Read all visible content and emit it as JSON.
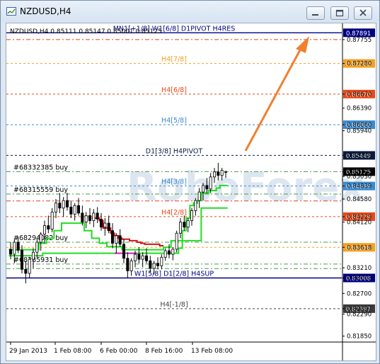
{
  "window": {
    "title": "NZDUSD,H4"
  },
  "chart_data": {
    "type": "candlestick",
    "symbol_line": "NZDUSD,H4  0.85111 0.85147 0.85001 0.85125",
    "price_labels": [
      "0.87755",
      "0.87280",
      "0.86670",
      "0.86390",
      "0.86060",
      "0.85940",
      "0.85449",
      "0.85125",
      "0.85030",
      "0.84839",
      "0.84580",
      "0.84229",
      "0.84120",
      "0.83618",
      "0.83210",
      "0.83008",
      "0.82700",
      "0.82397",
      "0.82290",
      "0.81850"
    ],
    "ylim": [
      0.8176,
      0.8805
    ],
    "time_labels": [
      "29 Jan 2013",
      "1 Feb 08:00",
      "6 Feb 00:00",
      "8 Feb 16:00",
      "13 Feb 08:00"
    ],
    "levels": [
      {
        "name": "MN1[+1/8] W1[6/8] D1PIVOT H4RES",
        "value": 0.87891,
        "badge": "0.87891",
        "color": "#000080",
        "style": "solid",
        "badge_bg": "#000080",
        "badge_fg": "#ffffff"
      },
      {
        "name": "",
        "value": 0.87755,
        "badge": "",
        "color": "#e04020",
        "style": "dashdot",
        "badge_bg": "",
        "badge_fg": ""
      },
      {
        "name": "H4[7/8]",
        "value": 0.8728,
        "badge": "0.87280",
        "color": "#f5a020",
        "style": "dash",
        "badge_bg": "#f5a020",
        "badge_fg": "#ffffff"
      },
      {
        "name": "H4[6/8]",
        "value": 0.8667,
        "badge": "0.86670",
        "color": "#e84818",
        "style": "dash",
        "badge_bg": "#e84818",
        "badge_fg": "#ffffff"
      },
      {
        "name": "H4[5/8]",
        "value": 0.8606,
        "badge": "0.86060",
        "color": "#3a8ad0",
        "style": "dash",
        "badge_bg": "#3a8ad0",
        "badge_fg": "#ffffff"
      },
      {
        "name": "D1[3/8] H4PIVOT",
        "value": 0.85449,
        "badge": "0.85449",
        "color": "#0a1a40",
        "style": "dash",
        "badge_bg": "#0a1a40",
        "badge_fg": "#ffffff"
      },
      {
        "name": "#68332385 buy",
        "value": 0.85125,
        "badge": "0.85125",
        "color": "#4a9a4a",
        "style": "dashdot",
        "badge_bg": "#000000",
        "badge_fg": "#ffffff"
      },
      {
        "name": "H4[3/8]",
        "value": 0.84839,
        "badge": "0.84839",
        "color": "#3a8ad0",
        "style": "dash",
        "badge_bg": "#3a8ad0",
        "badge_fg": "#ffffff"
      },
      {
        "name": "#68315559 buy",
        "value": 0.8468,
        "badge": "",
        "color": "#4a9a4a",
        "style": "dashdot",
        "badge_bg": "",
        "badge_fg": ""
      },
      {
        "name": "",
        "value": 0.84541,
        "badge": "",
        "color": "#e04020",
        "style": "dashdot",
        "badge_bg": "",
        "badge_fg": ""
      },
      {
        "name": "H4[2/8]",
        "value": 0.84229,
        "badge": "0.84229",
        "color": "#e84818",
        "style": "dash",
        "badge_bg": "#e84818",
        "badge_fg": "#ffffff"
      },
      {
        "name": "#68294082 buy",
        "value": 0.8372,
        "badge": "",
        "color": "#4a9a4a",
        "style": "dashdot",
        "badge_bg": "",
        "badge_fg": ""
      },
      {
        "name": "",
        "value": 0.83618,
        "badge": "0.83618",
        "color": "#f5a020",
        "style": "dash",
        "badge_bg": "#f5a020",
        "badge_fg": "#ffffff"
      },
      {
        "name": "",
        "value": 0.83195,
        "badge": "",
        "color": "#4a9a4a",
        "style": "dashdot",
        "badge_bg": "",
        "badge_fg": ""
      },
      {
        "name": "#68285931 buy",
        "value": 0.83285,
        "badge": "",
        "color": "#4a9a4a",
        "style": "dashdot",
        "badge_bg": "",
        "badge_fg": ""
      },
      {
        "name": "W1[5/8] D1[2/8] H4SUP",
        "value": 0.83008,
        "badge": "0.83008",
        "color": "#000080",
        "style": "solid",
        "badge_bg": "#000080",
        "badge_fg": "#ffffff"
      },
      {
        "name": "H4[-1/8]",
        "value": 0.82397,
        "badge": "0.82397",
        "color": "#444444",
        "style": "dash",
        "badge_bg": "#3a3a3a",
        "badge_fg": "#ffffff"
      }
    ],
    "candles": [
      [
        0.8358,
        0.8372,
        0.8338,
        0.8348
      ],
      [
        0.8348,
        0.8378,
        0.833,
        0.8372
      ],
      [
        0.8372,
        0.8382,
        0.835,
        0.8356
      ],
      [
        0.8356,
        0.8366,
        0.831,
        0.8318
      ],
      [
        0.8318,
        0.8335,
        0.829,
        0.831
      ],
      [
        0.831,
        0.8342,
        0.83,
        0.8338
      ],
      [
        0.8338,
        0.836,
        0.832,
        0.8352
      ],
      [
        0.8352,
        0.838,
        0.8342,
        0.8372
      ],
      [
        0.8372,
        0.8392,
        0.8355,
        0.8388
      ],
      [
        0.8388,
        0.8415,
        0.837,
        0.8405
      ],
      [
        0.8405,
        0.8425,
        0.839,
        0.8398
      ],
      [
        0.8398,
        0.844,
        0.8392,
        0.8432
      ],
      [
        0.8432,
        0.8458,
        0.842,
        0.845
      ],
      [
        0.845,
        0.847,
        0.843,
        0.844
      ],
      [
        0.844,
        0.8462,
        0.8422,
        0.8455
      ],
      [
        0.8455,
        0.847,
        0.8435,
        0.8442
      ],
      [
        0.8442,
        0.8455,
        0.842,
        0.8428
      ],
      [
        0.8428,
        0.845,
        0.8415,
        0.8445
      ],
      [
        0.8445,
        0.846,
        0.8425,
        0.843
      ],
      [
        0.843,
        0.8445,
        0.8405,
        0.8412
      ],
      [
        0.8412,
        0.8432,
        0.84,
        0.8425
      ],
      [
        0.8425,
        0.844,
        0.8408,
        0.8415
      ],
      [
        0.8415,
        0.8438,
        0.8402,
        0.843
      ],
      [
        0.843,
        0.8442,
        0.841,
        0.8418
      ],
      [
        0.8418,
        0.843,
        0.8395,
        0.8402
      ],
      [
        0.8402,
        0.842,
        0.8385,
        0.841
      ],
      [
        0.841,
        0.8425,
        0.839,
        0.8395
      ],
      [
        0.8395,
        0.841,
        0.836,
        0.837
      ],
      [
        0.837,
        0.839,
        0.835,
        0.8385
      ],
      [
        0.8385,
        0.8398,
        0.8362,
        0.8368
      ],
      [
        0.8368,
        0.8378,
        0.833,
        0.834
      ],
      [
        0.834,
        0.8352,
        0.83,
        0.8315
      ],
      [
        0.8315,
        0.834,
        0.8305,
        0.8335
      ],
      [
        0.8335,
        0.8355,
        0.8322,
        0.8348
      ],
      [
        0.8348,
        0.8362,
        0.833,
        0.8338
      ],
      [
        0.8338,
        0.8352,
        0.8322,
        0.8345
      ],
      [
        0.8345,
        0.836,
        0.833,
        0.8335
      ],
      [
        0.8335,
        0.8345,
        0.8312,
        0.832
      ],
      [
        0.832,
        0.8335,
        0.8308,
        0.833
      ],
      [
        0.833,
        0.8342,
        0.8318,
        0.8325
      ],
      [
        0.8325,
        0.8348,
        0.8318,
        0.8342
      ],
      [
        0.8342,
        0.836,
        0.8335,
        0.8355
      ],
      [
        0.8355,
        0.8368,
        0.834,
        0.8348
      ],
      [
        0.8348,
        0.8362,
        0.8336,
        0.8358
      ],
      [
        0.8358,
        0.8395,
        0.8352,
        0.839
      ],
      [
        0.839,
        0.842,
        0.838,
        0.8412
      ],
      [
        0.8412,
        0.8425,
        0.8395,
        0.8402
      ],
      [
        0.8402,
        0.842,
        0.8392,
        0.8415
      ],
      [
        0.8415,
        0.844,
        0.8405,
        0.8435
      ],
      [
        0.8435,
        0.846,
        0.8425,
        0.8455
      ],
      [
        0.8455,
        0.848,
        0.844,
        0.8472
      ],
      [
        0.8472,
        0.849,
        0.8455,
        0.8485
      ],
      [
        0.8485,
        0.85,
        0.847,
        0.8478
      ],
      [
        0.8478,
        0.851,
        0.847,
        0.8502
      ],
      [
        0.8502,
        0.852,
        0.849,
        0.8512
      ],
      [
        0.8512,
        0.853,
        0.8495,
        0.8505
      ],
      [
        0.8505,
        0.852,
        0.8495,
        0.8515
      ],
      [
        0.8511,
        0.85147,
        0.85001,
        0.85125
      ]
    ],
    "series": [
      {
        "name": "",
        "color": "#22dd22",
        "values": [
          0.8357,
          0.8357,
          0.8357,
          0.8357,
          0.8357,
          0.8357,
          0.8357,
          0.8357,
          0.837,
          0.837,
          0.838,
          0.838,
          0.8395,
          0.8395,
          0.841,
          0.841,
          0.841,
          0.841,
          0.841,
          0.841,
          0.8395,
          0.8395,
          0.838,
          0.838,
          0.837,
          0.837,
          0.8363,
          0.8363,
          0.8363,
          0.8363,
          0.8357,
          0.8357,
          0.8357,
          0.8357,
          0.8357,
          0.8357,
          0.8357,
          0.8357,
          0.8357,
          0.8357,
          0.8357,
          0.8362,
          0.8362,
          0.8375,
          0.8375,
          0.8375,
          0.8395,
          0.842,
          0.8445,
          0.845,
          0.8455,
          0.847,
          0.847,
          0.8475,
          0.8475,
          0.848,
          0.8485,
          0.8485
        ]
      },
      {
        "name": "",
        "color": "#22dd22",
        "values": [
          0.8345,
          0.8345,
          0.8345,
          0.8345,
          0.8345,
          0.8345,
          0.8345,
          0.8345,
          0.8345,
          0.835,
          0.835,
          0.835,
          0.835,
          0.835,
          0.835,
          0.835,
          0.835,
          0.835,
          0.835,
          0.835,
          0.835,
          0.835,
          0.835,
          0.835,
          0.835,
          0.835,
          0.835,
          0.835,
          0.835,
          0.835,
          0.835,
          0.835,
          0.835,
          0.835,
          0.835,
          0.835,
          0.835,
          0.835,
          0.835,
          0.835,
          0.835,
          0.835,
          0.835,
          0.835,
          0.835,
          0.836,
          0.8375,
          0.8375,
          0.8375,
          0.8375,
          0.8375,
          0.844,
          0.844,
          0.844,
          0.844,
          0.844,
          0.844,
          0.844
        ]
      },
      {
        "name": "",
        "color": "#dd1111",
        "values": [
          null,
          null,
          null,
          null,
          null,
          null,
          null,
          null,
          null,
          null,
          null,
          null,
          null,
          null,
          null,
          null,
          null,
          null,
          null,
          null,
          null,
          null,
          0.842,
          0.842,
          0.8415,
          0.84,
          0.84,
          0.839,
          0.8385,
          0.838,
          0.8378,
          0.8378,
          0.8375,
          0.8375,
          0.8372,
          0.837,
          0.8368,
          0.8368,
          0.8368,
          0.8368,
          0.8365,
          null,
          null,
          null,
          null,
          null,
          null,
          null,
          null,
          null,
          null,
          null,
          null,
          null,
          null,
          null,
          null,
          null
        ]
      },
      {
        "name": "",
        "color": "#dd22cc",
        "values": [
          null,
          null,
          null,
          null,
          null,
          null,
          null,
          null,
          null,
          null,
          null,
          null,
          null,
          null,
          null,
          null,
          null,
          null,
          null,
          null,
          null,
          null,
          null,
          null,
          null,
          null,
          null,
          null,
          0.835,
          0.835,
          0.835,
          0.835,
          0.835,
          0.835,
          null,
          null,
          null,
          null,
          null,
          null,
          null,
          null,
          null,
          null,
          null,
          null,
          null,
          null,
          null,
          null,
          null,
          null,
          null,
          null,
          null,
          null,
          null,
          null
        ]
      }
    ],
    "arrow_color": "#f08030",
    "watermark": "RoboForex"
  }
}
